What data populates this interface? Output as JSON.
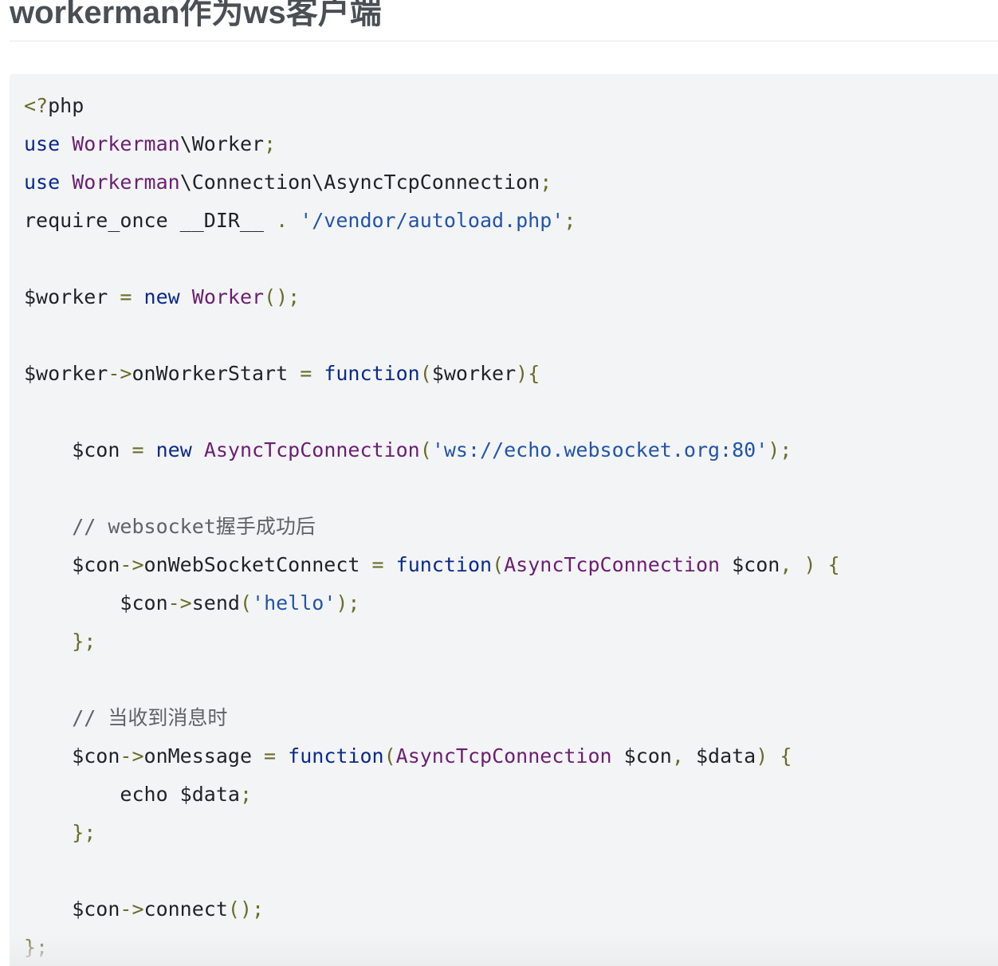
{
  "heading": "workerman作为ws客户端",
  "code_lines": [
    [
      {
        "c": "pu",
        "t": "<?"
      },
      {
        "c": "",
        "t": "php"
      }
    ],
    [
      {
        "c": "kw",
        "t": "use"
      },
      {
        "c": "",
        "t": " "
      },
      {
        "c": "ty",
        "t": "Workerman"
      },
      {
        "c": "",
        "t": "\\Worker"
      },
      {
        "c": "pu",
        "t": ";"
      }
    ],
    [
      {
        "c": "kw",
        "t": "use"
      },
      {
        "c": "",
        "t": " "
      },
      {
        "c": "ty",
        "t": "Workerman"
      },
      {
        "c": "",
        "t": "\\Connection\\AsyncTcpConnection"
      },
      {
        "c": "pu",
        "t": ";"
      }
    ],
    [
      {
        "c": "",
        "t": "require_once __DIR__ "
      },
      {
        "c": "pu",
        "t": "."
      },
      {
        "c": "",
        "t": " "
      },
      {
        "c": "st",
        "t": "'/vendor/autoload.php'"
      },
      {
        "c": "pu",
        "t": ";"
      }
    ],
    [],
    [
      {
        "c": "",
        "t": "$worker "
      },
      {
        "c": "pu",
        "t": "="
      },
      {
        "c": "",
        "t": " "
      },
      {
        "c": "kw",
        "t": "new"
      },
      {
        "c": "",
        "t": " "
      },
      {
        "c": "ty",
        "t": "Worker"
      },
      {
        "c": "pu",
        "t": "();"
      }
    ],
    [],
    [
      {
        "c": "",
        "t": "$worker"
      },
      {
        "c": "pu",
        "t": "->"
      },
      {
        "c": "",
        "t": "onWorkerStart "
      },
      {
        "c": "pu",
        "t": "="
      },
      {
        "c": "",
        "t": " "
      },
      {
        "c": "kw",
        "t": "function"
      },
      {
        "c": "pu",
        "t": "("
      },
      {
        "c": "",
        "t": "$worker"
      },
      {
        "c": "pu",
        "t": "){"
      }
    ],
    [],
    [
      {
        "c": "",
        "t": "    $con "
      },
      {
        "c": "pu",
        "t": "="
      },
      {
        "c": "",
        "t": " "
      },
      {
        "c": "kw",
        "t": "new"
      },
      {
        "c": "",
        "t": " "
      },
      {
        "c": "ty",
        "t": "AsyncTcpConnection"
      },
      {
        "c": "pu",
        "t": "("
      },
      {
        "c": "st",
        "t": "'ws://echo.websocket.org:80'"
      },
      {
        "c": "pu",
        "t": ");"
      }
    ],
    [],
    [
      {
        "c": "cm",
        "t": "    // websocket握手成功后"
      }
    ],
    [
      {
        "c": "",
        "t": "    $con"
      },
      {
        "c": "pu",
        "t": "->"
      },
      {
        "c": "",
        "t": "onWebSocketConnect "
      },
      {
        "c": "pu",
        "t": "="
      },
      {
        "c": "",
        "t": " "
      },
      {
        "c": "kw",
        "t": "function"
      },
      {
        "c": "pu",
        "t": "("
      },
      {
        "c": "ty",
        "t": "AsyncTcpConnection"
      },
      {
        "c": "",
        "t": " $con"
      },
      {
        "c": "pu",
        "t": ","
      },
      {
        "c": "",
        "t": " "
      },
      {
        "c": "pu",
        "t": ")"
      },
      {
        "c": "",
        "t": " "
      },
      {
        "c": "pu",
        "t": "{"
      }
    ],
    [
      {
        "c": "",
        "t": "        $con"
      },
      {
        "c": "pu",
        "t": "->"
      },
      {
        "c": "",
        "t": "send"
      },
      {
        "c": "pu",
        "t": "("
      },
      {
        "c": "st",
        "t": "'hello'"
      },
      {
        "c": "pu",
        "t": ");"
      }
    ],
    [
      {
        "c": "pu",
        "t": "    };"
      }
    ],
    [],
    [
      {
        "c": "cm",
        "t": "    // 当收到消息时"
      }
    ],
    [
      {
        "c": "",
        "t": "    $con"
      },
      {
        "c": "pu",
        "t": "->"
      },
      {
        "c": "",
        "t": "onMessage "
      },
      {
        "c": "pu",
        "t": "="
      },
      {
        "c": "",
        "t": " "
      },
      {
        "c": "kw",
        "t": "function"
      },
      {
        "c": "pu",
        "t": "("
      },
      {
        "c": "ty",
        "t": "AsyncTcpConnection"
      },
      {
        "c": "",
        "t": " $con"
      },
      {
        "c": "pu",
        "t": ","
      },
      {
        "c": "",
        "t": " $data"
      },
      {
        "c": "pu",
        "t": ")"
      },
      {
        "c": "",
        "t": " "
      },
      {
        "c": "pu",
        "t": "{"
      }
    ],
    [
      {
        "c": "",
        "t": "        echo $data"
      },
      {
        "c": "pu",
        "t": ";"
      }
    ],
    [
      {
        "c": "pu",
        "t": "    };"
      }
    ],
    [],
    [
      {
        "c": "",
        "t": "    $con"
      },
      {
        "c": "pu",
        "t": "->"
      },
      {
        "c": "",
        "t": "connect"
      },
      {
        "c": "pu",
        "t": "();"
      }
    ],
    [
      {
        "c": "pu",
        "t": "};"
      }
    ]
  ],
  "colors": {
    "keyword": "#0a2a8c",
    "type": "#6b1f72",
    "string": "#2255a8",
    "punctuation": "#6b6b2a",
    "comment": "#5f6368",
    "code_background": "#f3f4f5"
  }
}
